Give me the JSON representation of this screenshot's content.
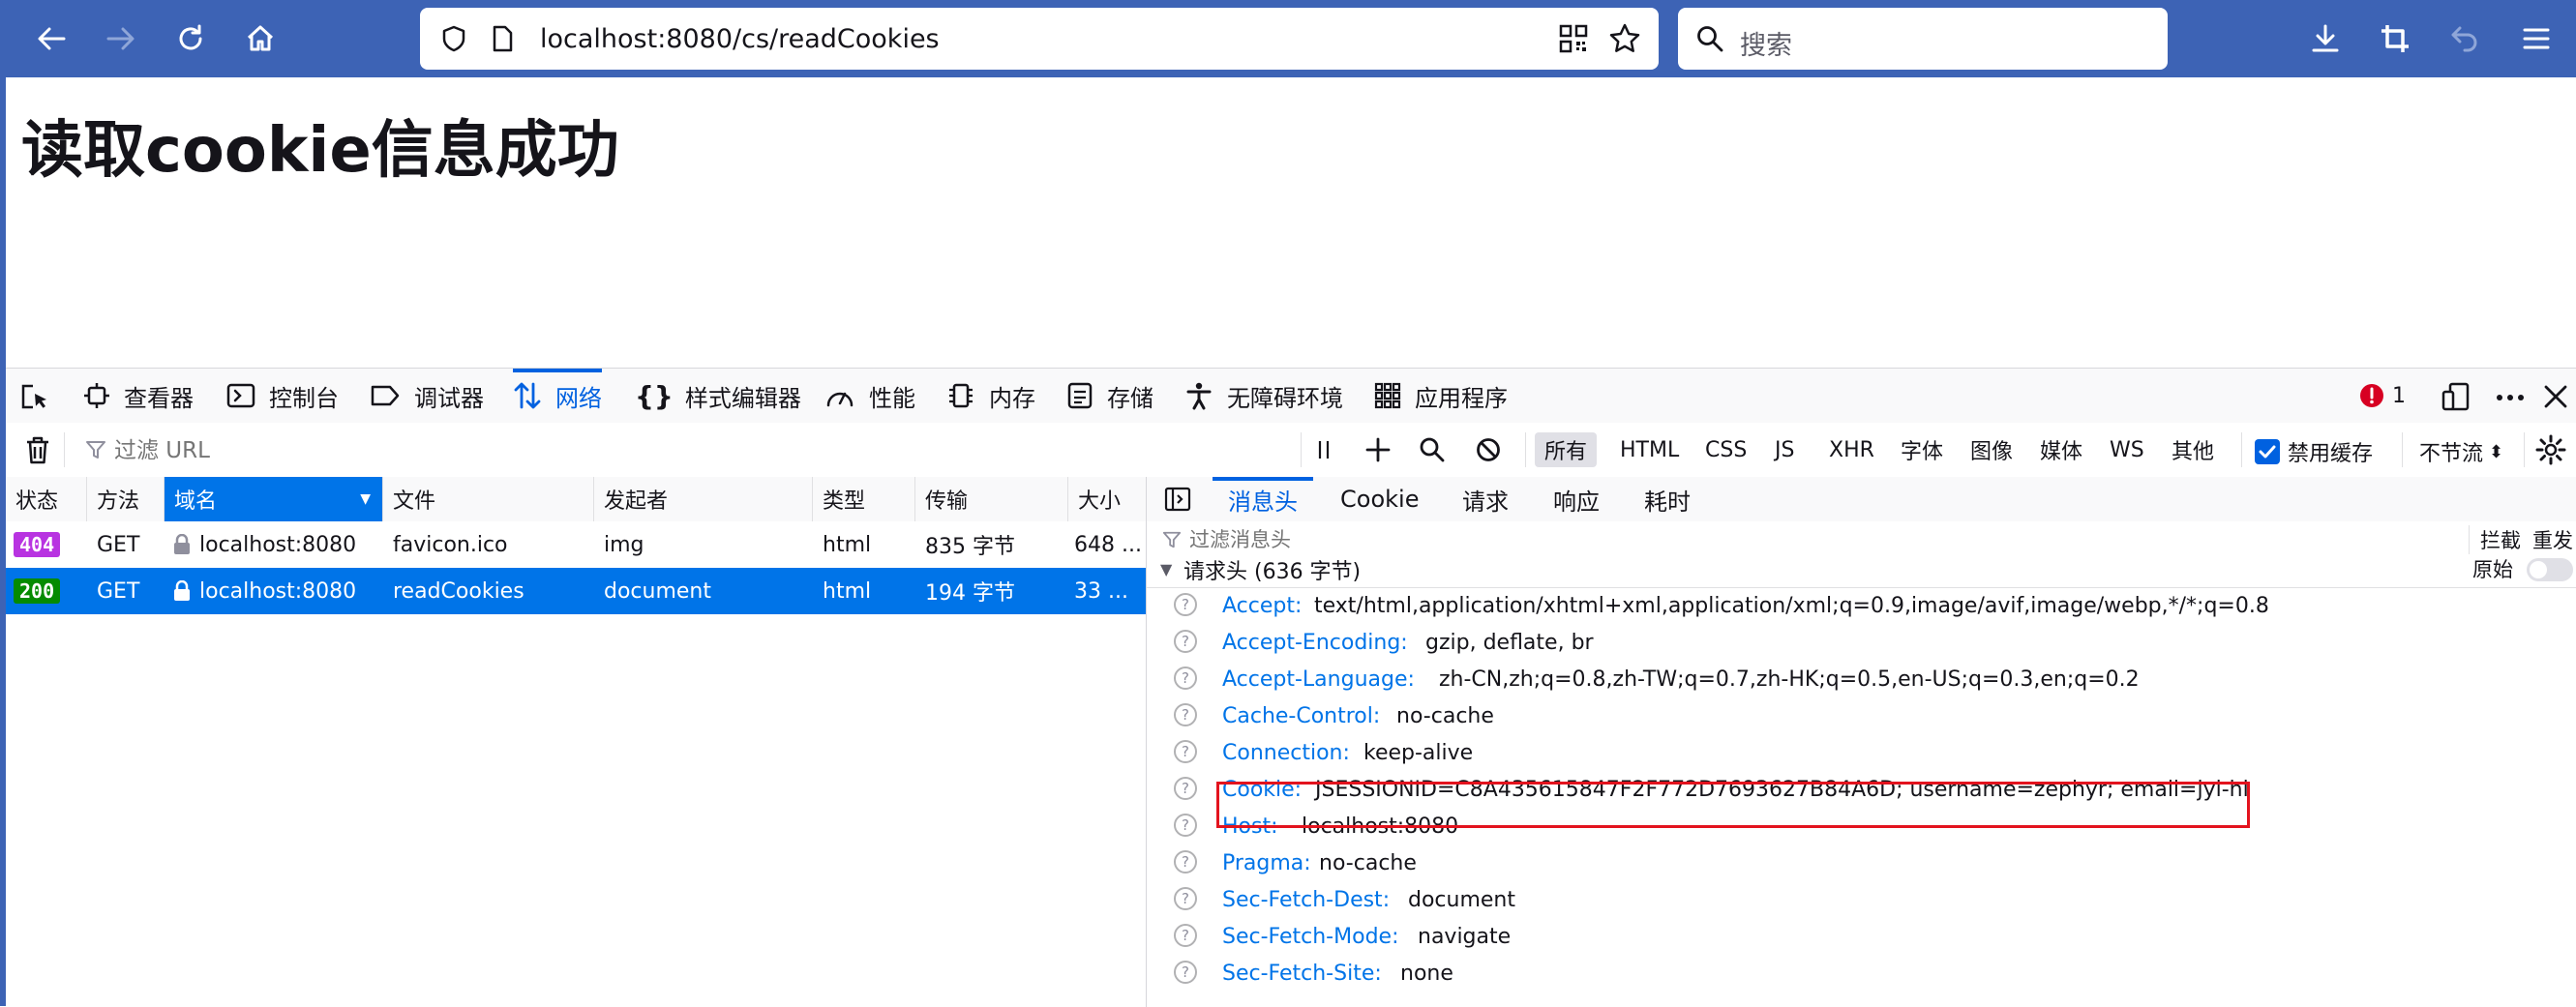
{
  "browser": {
    "url_host": "localhost",
    "url_rest": ":8080/cs/readCookies",
    "search_placeholder": "搜索"
  },
  "page": {
    "heading": "读取cookie信息成功"
  },
  "devtools": {
    "tabs": [
      {
        "label": "查看器",
        "icon": "inspector-icon"
      },
      {
        "label": "控制台",
        "icon": "console-icon"
      },
      {
        "label": "调试器",
        "icon": "debugger-icon"
      },
      {
        "label": "网络",
        "icon": "network-icon"
      },
      {
        "label": "样式编辑器",
        "icon": "style-editor-icon"
      },
      {
        "label": "性能",
        "icon": "performance-icon"
      },
      {
        "label": "内存",
        "icon": "memory-icon"
      },
      {
        "label": "存储",
        "icon": "storage-icon"
      },
      {
        "label": "无障碍环境",
        "icon": "accessibility-icon"
      },
      {
        "label": "应用程序",
        "icon": "application-icon"
      }
    ],
    "active_tab": "网络",
    "error_count": "1",
    "filter_placeholder": "过滤 URL",
    "type_filters": [
      "所有",
      "HTML",
      "CSS",
      "JS",
      "XHR",
      "字体",
      "图像",
      "媒体",
      "WS",
      "其他"
    ],
    "selected_type_filter": "所有",
    "disable_cache_label": "禁用缓存",
    "disable_cache_checked": true,
    "throttle_label": "不节流",
    "columns": [
      "状态",
      "方法",
      "域名",
      "文件",
      "发起者",
      "类型",
      "传输",
      "大小"
    ],
    "sorted_column": "域名",
    "requests": [
      {
        "status": "404",
        "method": "GET",
        "domain": "localhost:8080",
        "file": "favicon.ico",
        "initiator": "img",
        "type": "html",
        "transferred": "835 字节",
        "size": "648 ...",
        "selected": false
      },
      {
        "status": "200",
        "method": "GET",
        "domain": "localhost:8080",
        "file": "readCookies",
        "initiator": "document",
        "type": "html",
        "transferred": "194 字节",
        "size": "33 ...",
        "selected": true
      }
    ],
    "details": {
      "tabs": [
        "消息头",
        "Cookie",
        "请求",
        "响应",
        "耗时"
      ],
      "active_tab": "消息头",
      "filter_placeholder": "过滤消息头",
      "block_label": "拦截",
      "resend_label": "重发",
      "section_title": "请求头 (636 字节)",
      "raw_label": "原始",
      "headers": [
        {
          "name": "Accept:",
          "value": "text/html,application/xhtml+xml,application/xml;q=0.9,image/avif,image/webp,*/*;q=0.8"
        },
        {
          "name": "Accept-Encoding:",
          "value": "gzip, deflate, br"
        },
        {
          "name": "Accept-Language:",
          "value": "zh-CN,zh;q=0.8,zh-TW;q=0.7,zh-HK;q=0.5,en-US;q=0.3,en;q=0.2"
        },
        {
          "name": "Cache-Control:",
          "value": "no-cache"
        },
        {
          "name": "Connection:",
          "value": "keep-alive"
        },
        {
          "name": "Cookie:",
          "value": "JSESSIONID=C8A435615847F2F772D7693627B84A6D; username=zephyr; email=jyl-hi"
        },
        {
          "name": "Host:",
          "value": "localhost:8080"
        },
        {
          "name": "Pragma:",
          "value": "no-cache"
        },
        {
          "name": "Sec-Fetch-Dest:",
          "value": "document"
        },
        {
          "name": "Sec-Fetch-Mode:",
          "value": "navigate"
        },
        {
          "name": "Sec-Fetch-Site:",
          "value": "none"
        }
      ]
    }
  },
  "colors": {
    "toolbar": "#3d63b5",
    "accent": "#0074e8",
    "status_404": "#b833e1",
    "status_200": "#058b00",
    "annotation": "#e3131e"
  }
}
